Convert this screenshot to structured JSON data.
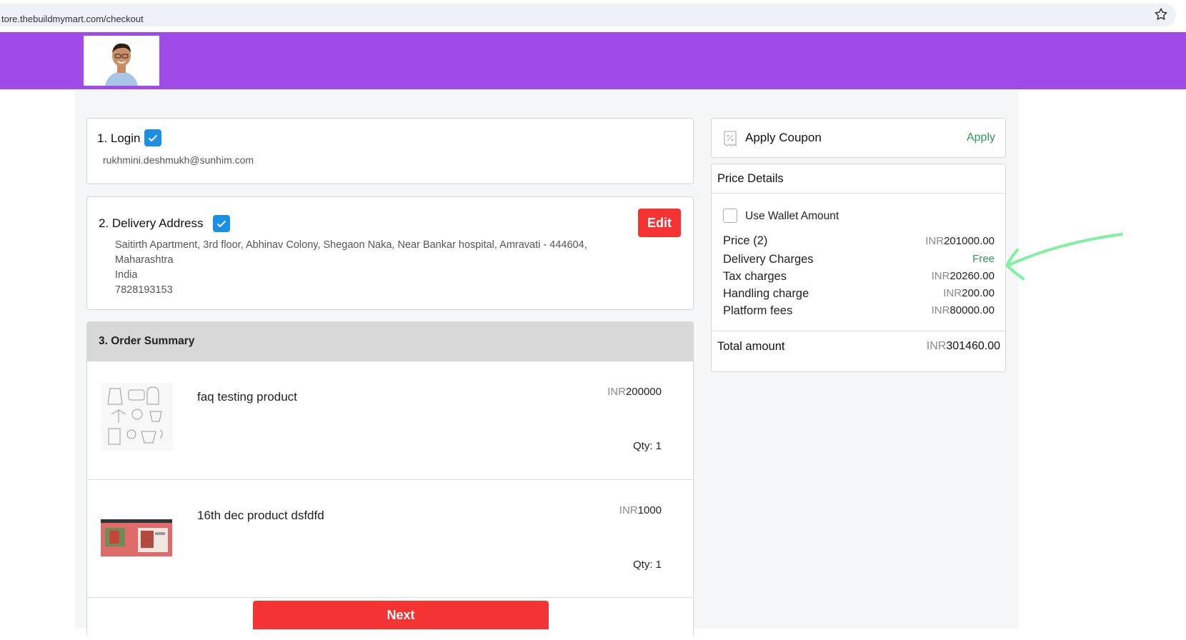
{
  "browser": {
    "url": "tore.thebuildmymart.com/checkout"
  },
  "steps": {
    "login": {
      "title": "1. Login",
      "email": "rukhmini.deshmukh@sunhim.com"
    },
    "delivery": {
      "title": "2. Delivery Address",
      "edit_label": "Edit",
      "address_lines": [
        "Saitirth Apartment, 3rd floor, Abhinav Colony, Shegaon Naka, Near Bankar hospital, Amravati - 444604,",
        "Maharashtra",
        "India",
        "7828193153"
      ]
    },
    "order_summary": {
      "title": "3. Order Summary",
      "items": [
        {
          "name": "faq testing product",
          "currency": "INR",
          "price": "200000",
          "qty": "Qty: 1"
        },
        {
          "name": "16th dec product dsfdfd",
          "currency": "INR",
          "price": "1000",
          "qty": "Qty: 1"
        }
      ],
      "next_label": "Next"
    }
  },
  "coupon": {
    "label": "Apply Coupon",
    "apply_label": "Apply"
  },
  "price_details": {
    "title": "Price Details",
    "wallet_label": "Use Wallet Amount",
    "rows": [
      {
        "label": "Price (2)",
        "currency": "INR",
        "value": "201000.00"
      },
      {
        "label": "Delivery Charges",
        "currency": "",
        "value": "Free"
      },
      {
        "label": "Tax charges",
        "currency": "INR",
        "value": "20260.00"
      },
      {
        "label": "Handling charge",
        "currency": "INR",
        "value": "200.00"
      },
      {
        "label": "Platform fees",
        "currency": "INR",
        "value": "80000.00"
      }
    ],
    "total_label": "Total amount",
    "total_currency": "INR",
    "total_value": "301460.00"
  },
  "colors": {
    "header_bg": "#a04be8",
    "button_red": "#f43432",
    "check_blue": "#1a8fe3",
    "green": "#2e9a5a",
    "annotation_arrow": "#7ef0a0"
  },
  "icons": [
    "star-icon",
    "check-icon",
    "coupon-icon",
    "annotation-arrow"
  ]
}
